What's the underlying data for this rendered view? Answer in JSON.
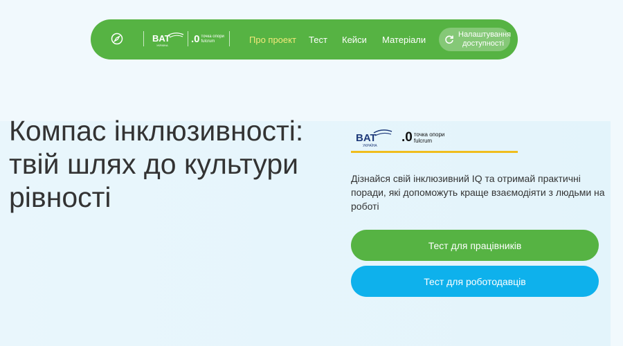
{
  "nav": {
    "logos": {
      "bat": "BAT",
      "bat_sub": "УКРАЇНА",
      "fulcrum_mark": ".0",
      "fulcrum_line1": "точка опори",
      "fulcrum_line2": "fulcrum"
    },
    "links": [
      {
        "label": "Про проект",
        "active": true
      },
      {
        "label": "Тест",
        "active": false
      },
      {
        "label": "Кейси",
        "active": false
      },
      {
        "label": "Матеріали",
        "active": false
      }
    ],
    "accessibility_label": "Налаштування доступності"
  },
  "hero": {
    "title": "Компас інклюзивності: твій шлях до культури рівності"
  },
  "card": {
    "logos": {
      "bat": "BAT",
      "bat_sub": "УКРАЇНА",
      "fulcrum_mark": ".0",
      "fulcrum_line1": "точка опори",
      "fulcrum_line2": "fulcrum"
    },
    "description": "Дізнайся свій інклюзивний IQ та отримай практичні поради, які допоможуть краще взаємодіяти з людьми на роботі",
    "btn_employee": "Тест для працівників",
    "btn_employer": "Тест для роботодавців"
  },
  "colors": {
    "green": "#56b343",
    "blue": "#0eb1ec",
    "yellow": "#f0bd1d",
    "active_link": "#f3e87a"
  }
}
